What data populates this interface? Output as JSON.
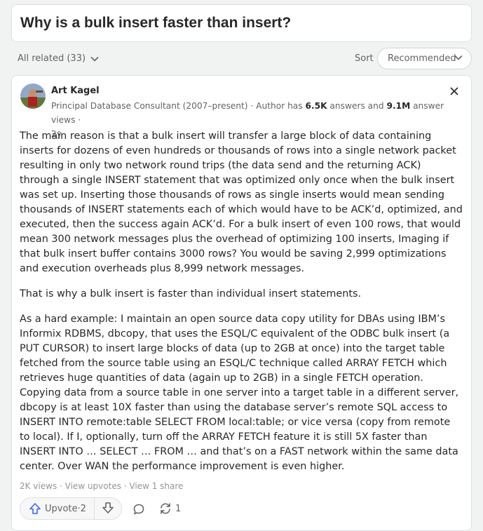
{
  "question": {
    "title": "Why is a bulk insert faster than insert?"
  },
  "filters": {
    "all_related": "All related (33)",
    "sort_label": "Sort",
    "sort_value": "Recommended"
  },
  "answer": {
    "author": {
      "name": "Art Kagel",
      "credential_prefix": "Principal Database Consultant (2007–present) · Author has ",
      "answers_count": "6.5K",
      "answers_text": " answers and ",
      "views_count": "9.1M",
      "views_text": " answer views ·",
      "age": "2y"
    },
    "paragraphs": [
      "The main reason is that a bulk insert will transfer a large block of data containing inserts for dozens of even hundreds or thousands of rows into a single network packet resulting in only two network round trips (the data send and the returning ACK) through a single INSERT statement that was optimized only once when the bulk insert was set up. Inserting those thousands of rows as single inserts would mean sending thousands of INSERT statements each of which would have to be ACK’d, optimized, and executed, then the success again ACK’d. For a bulk insert of even 100 rows, that would mean 300 network messages plus the overhead of optimizing 100 inserts, Imaging if that bulk insert buffer contains 3000 rows? You would be saving 2,999 optimizations and execution overheads plus 8,999 network messages.",
      "That is why a bulk insert is faster than individual insert statements.",
      "As a hard example: I maintain an open source data copy utility for DBAs using IBM’s Informix RDBMS, dbcopy, that uses the ESQL/C equivalent of the ODBC bulk insert (a PUT CURSOR) to insert large blocks of data (up to 2GB at once) into the target table fetched from the source table using an ESQL/C technique called ARRAY FETCH which retrieves huge quantities of data (again up to 2GB) in a single FETCH operation. Copying data from a source table in one server into a target table in a different server, dbcopy is at least 10X faster than using the database server’s remote SQL access to INSERT INTO remote:table SELECT FROM local:table; or vice versa (copy from remote to local). If I, optionally, turn off the ARRAY FETCH feature it is still 5X faster than INSERT INTO … SELECT … FROM … and that’s on a FAST network within the same data center. Over WAN the performance improvement is even higher."
    ],
    "stats": {
      "views": "2K views",
      "sep1": " · ",
      "view_upvotes": "View upvotes",
      "sep2": " · ",
      "view_shares": "View 1 share"
    },
    "actions": {
      "upvote_label": "Upvote",
      "upvote_sep": " · ",
      "upvote_count": "2",
      "share_count": "1"
    }
  },
  "colors": {
    "accent_blue": "#2e69ff",
    "text": "#282829",
    "muted": "#636466"
  },
  "icons": [
    "chevron-down-icon",
    "close-icon",
    "upvote-arrow-icon",
    "downvote-arrow-icon",
    "comment-icon",
    "share-icon"
  ]
}
